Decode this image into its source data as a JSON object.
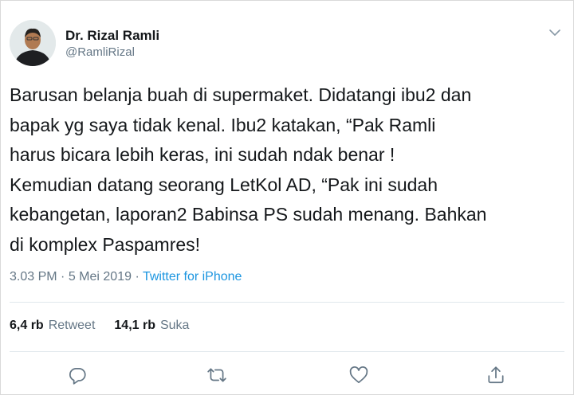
{
  "user": {
    "display_name": "Dr. Rizal Ramli",
    "handle": "@RamliRizal"
  },
  "tweet": {
    "text": "Barusan belanja buah di supermaket. Didatangi ibu2 dan\nbapak yg saya tidak kenal. Ibu2 katakan, “Pak Ramli\nharus bicara lebih keras, ini sudah ndak benar !\nKemudian datang seorang LetKol AD, “Pak ini sudah\nkebangetan, laporan2 Babinsa PS sudah menang. Bahkan\ndi komplex Paspamres!",
    "time": "3.03 PM",
    "separator": "·",
    "date": "5 Mei 2019",
    "source": "Twitter for iPhone"
  },
  "stats": {
    "retweets_count": "6,4 rb",
    "retweets_label": "Retweet",
    "likes_count": "14,1 rb",
    "likes_label": "Suka"
  },
  "icons": {
    "menu": "chevron-down-icon",
    "reply": "reply-icon",
    "retweet": "retweet-icon",
    "like": "heart-icon",
    "share": "share-icon"
  },
  "colors": {
    "text": "#14171a",
    "secondary": "#657786",
    "link": "#1b95e0",
    "divider": "#e1e8ed"
  }
}
